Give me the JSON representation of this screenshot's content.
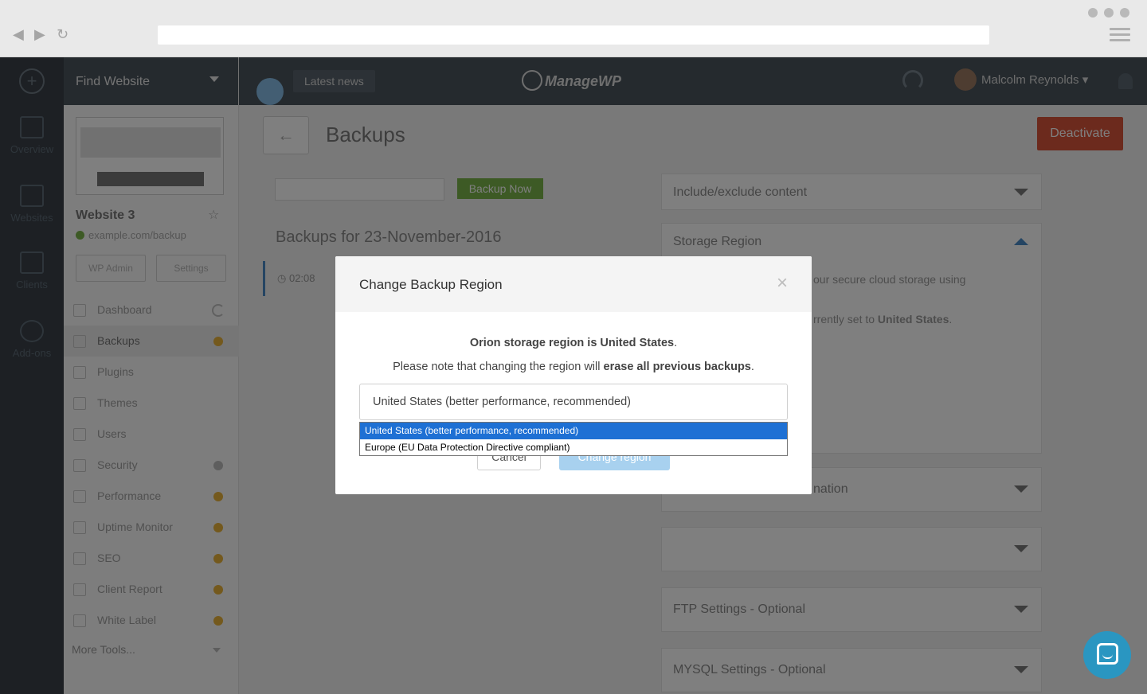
{
  "app": {
    "find_website": "Find Website",
    "latest_news": "Latest news",
    "logo": "ManageWP",
    "user_name": "Malcolm Reynolds",
    "left_nav": [
      "Overview",
      "Websites",
      "Clients",
      "Add-ons"
    ]
  },
  "site": {
    "name": "Website 3",
    "url": "example.com/backup",
    "wp_admin": "WP Admin",
    "settings": "Settings"
  },
  "menu": {
    "items": [
      {
        "label": "Dashboard"
      },
      {
        "label": "Backups"
      },
      {
        "label": "Plugins"
      },
      {
        "label": "Themes"
      },
      {
        "label": "Users"
      },
      {
        "label": "Security"
      },
      {
        "label": "Performance"
      },
      {
        "label": "Uptime Monitor"
      },
      {
        "label": "SEO"
      },
      {
        "label": "Client Report"
      },
      {
        "label": "White Label"
      }
    ],
    "more_tools": "More Tools..."
  },
  "page": {
    "title": "Backups",
    "deactivate": "Deactivate",
    "backup_now": "Backup Now",
    "backups_for": "Backups for 23-November-2016",
    "time": "02:08"
  },
  "panels": {
    "include_exclude": "Include/exclude content",
    "storage_region": "Storage Region",
    "storage_text1": "our secure cloud storage using",
    "storage_text2_prefix": "rrently set to ",
    "storage_text2_bold": "United States",
    "storage_text2_suffix": ".",
    "nation": "nation",
    "ftp": "FTP Settings - Optional",
    "mysql": "MYSQL Settings - Optional"
  },
  "modal": {
    "title": "Change Backup Region",
    "close": "×",
    "line1_bold": "Orion storage region is United States",
    "line1_suffix": ".",
    "line2_prefix": "Please note that changing the region will ",
    "line2_bold": "erase all previous backups",
    "line2_suffix": ".",
    "selected_value": "United States (better performance, recommended)",
    "cancel_label": "Cancel",
    "change_label": "Change region",
    "options": [
      "United States (better performance, recommended)",
      "Europe (EU Data Protection Directive compliant)"
    ]
  },
  "colors": {
    "overlay": "rgba(0,0,0,0.5)",
    "selected_option": "#1e70d4",
    "primary_disabled": "#a8d1ef",
    "deactivate": "#d8553a",
    "chat": "#2a96c1"
  }
}
